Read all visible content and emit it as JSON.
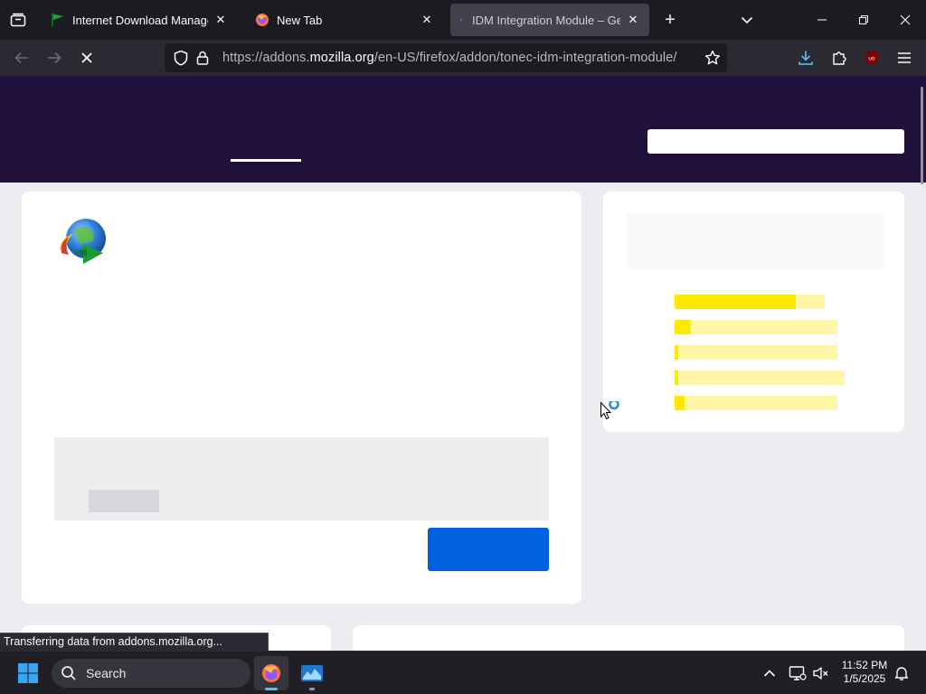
{
  "browser": {
    "tabs": [
      {
        "title": "Internet Download Manager is a",
        "active": false
      },
      {
        "title": "New Tab",
        "active": false
      },
      {
        "title": "IDM Integration Module – Get t",
        "active": true
      }
    ],
    "url": {
      "prefix": "https://addons.",
      "domain": "mozilla.org",
      "path": "/en-US/firefox/addon/tonec-idm-integration-module/"
    },
    "status_text": "Transferring data from addons.mozilla.org..."
  },
  "page": {
    "ratings": [
      0.81,
      0.1,
      0.02,
      0.02,
      0.06
    ]
  },
  "taskbar": {
    "search_label": "Search",
    "time": "11:52 PM",
    "date": "1/5/2025"
  },
  "colors": {
    "hero_bg": "#20123a",
    "install_button": "#0061e0",
    "rating_fill": "#ffe900",
    "rating_track": "#fff6a8",
    "page_bg": "#ebedf0"
  }
}
